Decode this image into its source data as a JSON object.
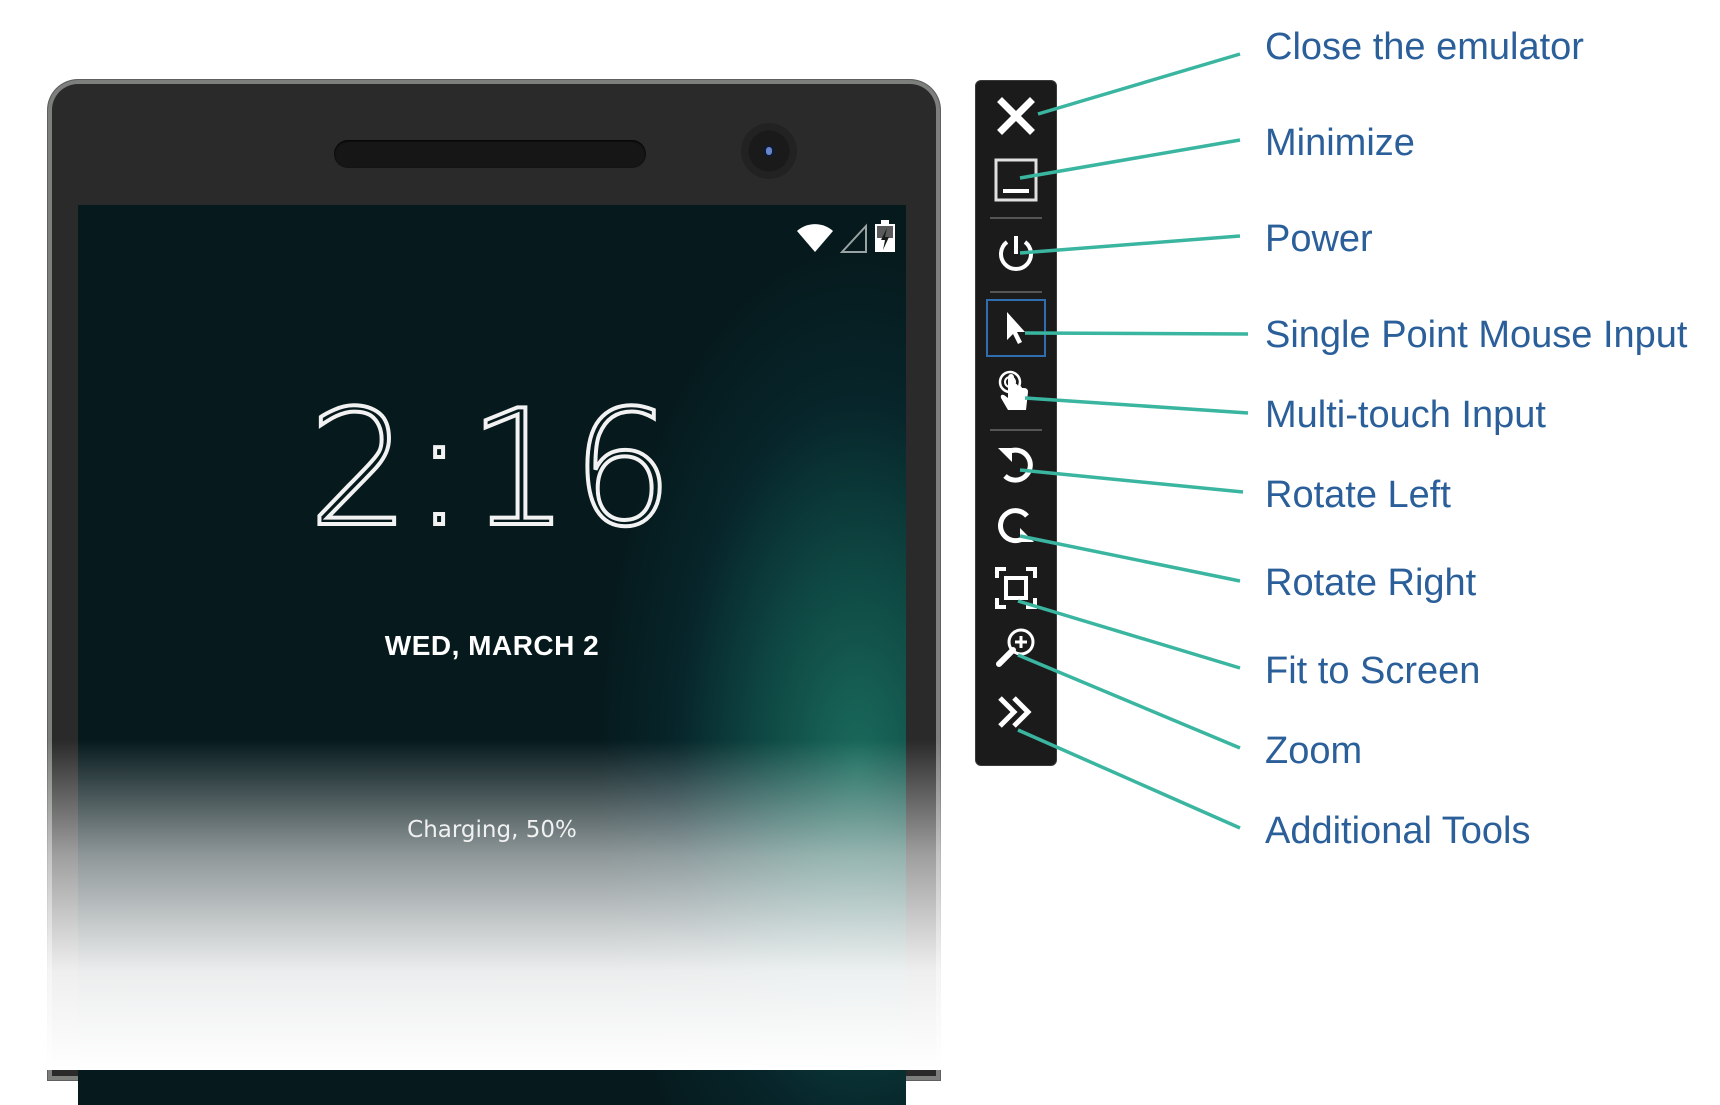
{
  "lockscreen": {
    "time_hours": "2",
    "time_colon": ":",
    "time_minutes": "16",
    "date": "WED, MARCH 2",
    "charging": "Charging, 50%"
  },
  "status_icons": [
    "wifi-icon",
    "cell-signal-icon",
    "battery-charging-icon"
  ],
  "toolbar": {
    "buttons": [
      {
        "name": "close-button",
        "icon": "close-icon"
      },
      {
        "name": "minimize-button",
        "icon": "minimize-icon"
      },
      {
        "name": "power-button",
        "icon": "power-icon"
      },
      {
        "name": "single-point-mouse-input-button",
        "icon": "cursor-arrow-icon",
        "selected": true
      },
      {
        "name": "multi-touch-input-button",
        "icon": "touch-hand-icon"
      },
      {
        "name": "rotate-left-button",
        "icon": "rotate-left-icon"
      },
      {
        "name": "rotate-right-button",
        "icon": "rotate-right-icon"
      },
      {
        "name": "fit-to-screen-button",
        "icon": "fit-to-screen-icon"
      },
      {
        "name": "zoom-button",
        "icon": "zoom-icon"
      },
      {
        "name": "additional-tools-button",
        "icon": "double-chevron-right-icon"
      }
    ]
  },
  "callouts": {
    "close": "Close the emulator",
    "minimize": "Minimize",
    "power": "Power",
    "single_point": "Single Point Mouse Input",
    "multi_touch": "Multi-touch Input",
    "rotate_left": "Rotate Left",
    "rotate_right": "Rotate Right",
    "fit": "Fit to Screen",
    "zoom": "Zoom",
    "additional": "Additional Tools"
  },
  "colors": {
    "callout_text": "#2b5f9a",
    "callout_line": "#3ab6a0",
    "toolbar_bg": "#1b1b1b",
    "selected_border": "#2f6fb0"
  }
}
